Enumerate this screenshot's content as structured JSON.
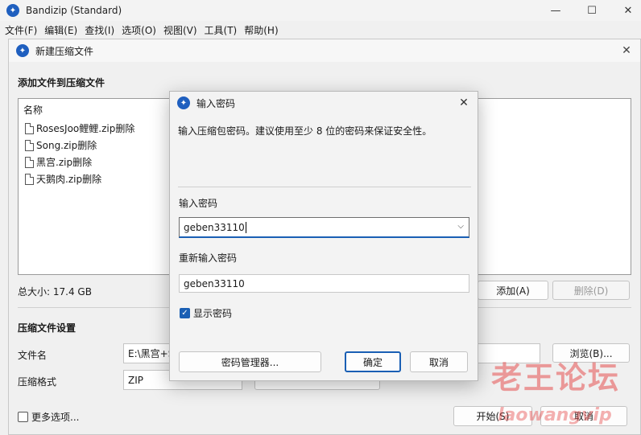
{
  "window": {
    "title": "Bandizip (Standard)",
    "min_glyph": "—",
    "max_glyph": "☐",
    "close_glyph": "✕"
  },
  "menu": [
    "文件(F)",
    "编辑(E)",
    "查找(I)",
    "选项(O)",
    "视图(V)",
    "工具(T)",
    "帮助(H)"
  ],
  "new_archive": {
    "title": "新建压缩文件",
    "add_files_label": "添加文件到压缩文件",
    "column_name": "名称",
    "files": [
      "RosesJoo鲤鲤.zip删除",
      "Song.zip删除",
      "黑宫.zip删除",
      "天鹅肉.zip删除"
    ],
    "total_size": "总大小: 17.4 GB",
    "add_button": "添加(A)",
    "delete_button": "删除(D)",
    "settings_label": "压缩文件设置",
    "filename_label": "文件名",
    "filename_value": "E:\\黑宫+S",
    "browse_button": "浏览(B)...",
    "format_label": "压缩格式",
    "format_value": "ZIP",
    "more_options": "更多选项...",
    "start_button": "开始(S)",
    "cancel_button": "取消"
  },
  "password_dialog": {
    "title": "输入密码",
    "description": "输入压缩包密码。建议使用至少 8 位的密码来保证安全性。",
    "password_label": "输入密码",
    "password_value": "geben33110",
    "reenter_label": "重新输入密码",
    "reenter_value": "geben33110",
    "show_password": "显示密码",
    "manager_button": "密码管理器...",
    "ok_button": "确定",
    "cancel_button": "取消"
  },
  "watermark": {
    "text_cn": "老王论坛",
    "text_en": "laowangvip"
  },
  "colors": {
    "accent": "#1a5fb4",
    "watermark": "#e65050"
  }
}
